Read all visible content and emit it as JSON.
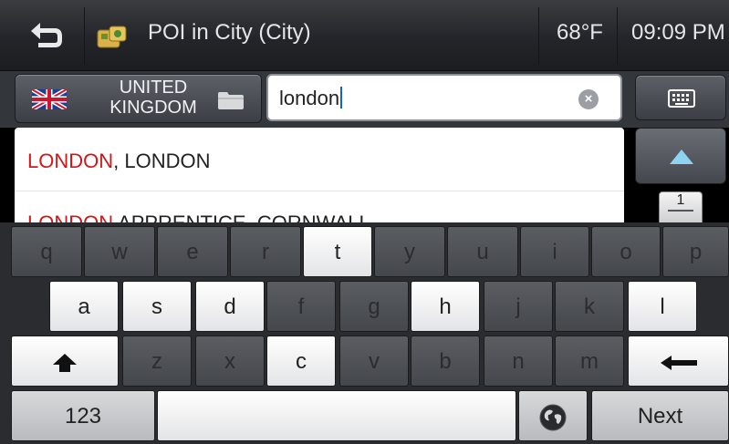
{
  "header": {
    "title": "POI in City (City)",
    "temperature": "68°F",
    "time": "09:09 PM",
    "back_icon": "back-arrow-icon",
    "poi_icon": "poi-category-icon"
  },
  "search": {
    "country": "UNITED KINGDOM",
    "country_line1": "UNITED",
    "country_line2": "KINGDOM",
    "flag_icon": "uk-flag-icon",
    "folder_icon": "folder-icon",
    "query": "london",
    "clear_icon": "clear-icon",
    "keyboard_icon": "keyboard-icon"
  },
  "results": [
    {
      "match": "LONDON",
      "rest": ", LONDON"
    },
    {
      "match": "LONDON",
      "rest": " APPRENTICE, CORNWALL"
    }
  ],
  "pager": {
    "page": "1"
  },
  "keyboard": {
    "row1": [
      "q",
      "w",
      "e",
      "r",
      "t",
      "y",
      "u",
      "i",
      "o",
      "p"
    ],
    "row2": [
      "a",
      "s",
      "d",
      "f",
      "g",
      "h",
      "j",
      "k",
      "l"
    ],
    "row3": [
      "z",
      "x",
      "c",
      "v",
      "b",
      "n",
      "m"
    ],
    "numbers_label": "123",
    "next_label": "Next",
    "shift_icon": "shift-icon",
    "backspace_icon": "backspace-icon",
    "globe_icon": "globe-icon"
  },
  "colors": {
    "highlight": "#d01818",
    "caret": "#1561c6"
  }
}
